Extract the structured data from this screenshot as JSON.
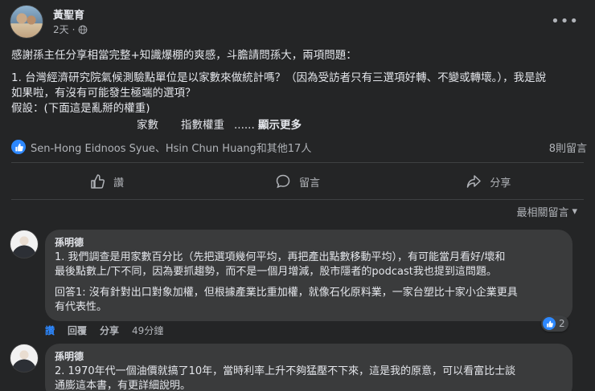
{
  "post": {
    "author": "黃聖育",
    "time": "2天",
    "more_icon": "more-horizontal-icon",
    "paragraph1": "感謝孫主任分享相當完整+知識爆棚的爽感，斗膽請問孫大，兩項問題：",
    "paragraph2_line1": "1. 台灣經濟研究院氣候測驗點單位是以家數來做統計嗎？（因為受訪者只有三選項好轉、不變或轉壞。），我是說",
    "paragraph2_line2": "如果啦，有沒有可能發生極端的選項？",
    "paragraph2_line3": "假設：(下面這是亂掰的權重)",
    "table_col1": "家數",
    "table_col2": "指數權重",
    "ellipsis": "......",
    "see_more": "顯示更多"
  },
  "reactions": {
    "names": "Sen-Hong Eidnoos Syue、Hsin Chun Huang和其他17人",
    "share_count": "8則留言"
  },
  "actions": {
    "like": "讚",
    "comment": "留言",
    "share": "分享"
  },
  "sort": {
    "label": "最相關留言"
  },
  "comments": [
    {
      "name": "孫明德",
      "line1": "1. 我們調查是用家數百分比（先把選項幾何平均，再把產出點數移動平均），有可能當月看好/壞和",
      "line2": "最後點數上/下不同，因為要抓趨勢，而不是一個月增減，股市隱者的podcast我也提到這問題。",
      "line3": "回答1: 沒有針對出口對象加權，但根據產業比重加權，就像石化原料業，一家台塑比十家小企業更具",
      "line4": "有代表性。",
      "like": "讚",
      "reply": "回覆",
      "share": "分享",
      "time": "49分鐘",
      "reaction_count": "2"
    },
    {
      "name": "孫明德",
      "line1": "2. 1970年代一個油價就搞了10年，當時利率上升不夠猛壓不下來，這是我的原意，可以看富比士談",
      "line2": "通膨這本書，有更詳細說明。"
    }
  ],
  "colors": {
    "background": "#242526",
    "bubble": "#3a3b3c",
    "text": "#e4e6eb",
    "secondary": "#b0b3b8",
    "accent": "#2d88ff"
  }
}
